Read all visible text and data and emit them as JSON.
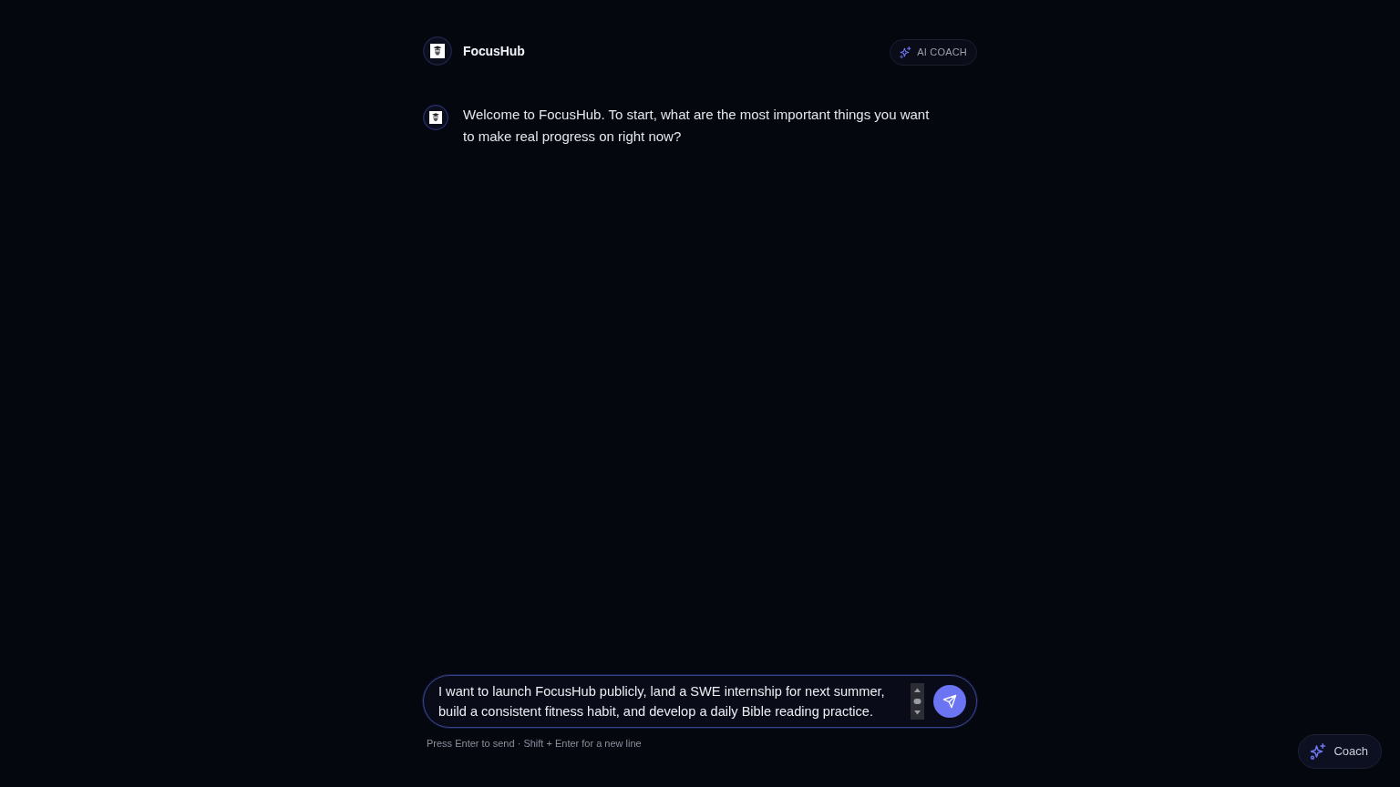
{
  "header": {
    "app_name": "FocusHub",
    "badge": "AI COACH"
  },
  "messages": [
    {
      "kind": "assistant",
      "text": "Welcome to FocusHub. To start, what are the most important things you want to make real progress on right now?"
    }
  ],
  "composer": {
    "value": "I want to launch FocusHub publicly, land a SWE internship for next summer, build a consistent fitness habit, and develop a daily Bible reading practice.",
    "hint": "Press Enter to send · Shift + Enter for a new line"
  },
  "floating_button": {
    "label": "Coach"
  }
}
